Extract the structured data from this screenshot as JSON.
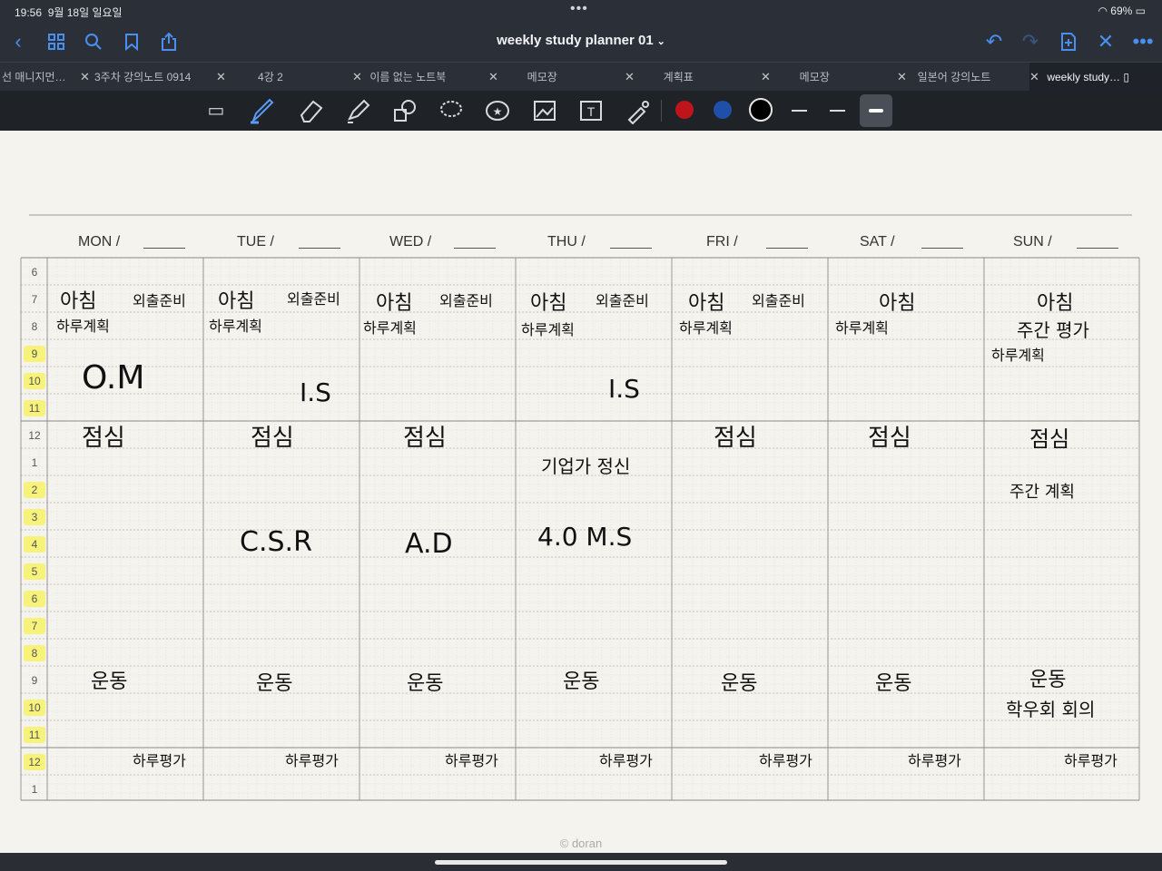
{
  "status": {
    "time": "19:56",
    "date": "9월 18일 일요일",
    "battery": "69%"
  },
  "nav": {
    "title": "weekly study planner 01",
    "left_icons": [
      "back-icon",
      "grid-icon",
      "search-icon",
      "bookmark-icon",
      "share-icon"
    ],
    "right_icons": [
      "undo-icon",
      "redo-icon",
      "add-page-icon",
      "close-icon",
      "more-icon"
    ]
  },
  "tabs": [
    {
      "label": "선 매니지먼…"
    },
    {
      "label": "3주차 강의노트 0914"
    },
    {
      "label": "4강 2"
    },
    {
      "label": "이름 없는 노트북"
    },
    {
      "label": "메모장"
    },
    {
      "label": "계획표"
    },
    {
      "label": "메모장"
    },
    {
      "label": "일본어 강의노트"
    },
    {
      "label": "weekly study…"
    }
  ],
  "toolbar": {
    "tools": [
      "read-mode-icon",
      "pen-icon",
      "eraser-icon",
      "highlighter-icon",
      "shapes-icon",
      "lasso-icon",
      "sticker-icon",
      "image-icon",
      "text-icon",
      "laser-pointer-icon"
    ],
    "colors": [
      "#c0141c",
      "#1f4fa8",
      "#111111"
    ]
  },
  "planner": {
    "days": [
      "MON /",
      "TUE /",
      "WED /",
      "THU /",
      "FRI /",
      "SAT /",
      "SUN /"
    ],
    "hours": [
      "6",
      "7",
      "8",
      "9",
      "10",
      "11",
      "12",
      "1",
      "2",
      "3",
      "4",
      "5",
      "6",
      "7",
      "8",
      "9",
      "10",
      "11",
      "12",
      "1"
    ],
    "highlighted_hour_rows": [
      3,
      4,
      5,
      8,
      9,
      10,
      11,
      12,
      13,
      14,
      16,
      17,
      18
    ],
    "entries": {
      "mon_morning": "아침",
      "mon_prep": "외출준비",
      "mon_plan": "하루계획",
      "mon_block": "O.M",
      "mon_lunch": "점심",
      "mon_exercise": "운동",
      "mon_review": "하루평가",
      "tue_morning": "아침",
      "tue_prep": "외출준비",
      "tue_plan": "하루계획",
      "tue_block1": "I.S",
      "tue_lunch": "점심",
      "tue_block2": "C.S.R",
      "tue_exercise": "운동",
      "tue_review": "하루평가",
      "wed_morning": "아침",
      "wed_prep": "외출준비",
      "wed_plan": "하루계획",
      "wed_lunch": "점심",
      "wed_block": "A.D",
      "wed_exercise": "운동",
      "wed_review": "하루평가",
      "thu_morning": "아침",
      "thu_prep": "외출준비",
      "thu_plan": "하루계획",
      "thu_block1": "I.S",
      "thu_spirit": "기업가 정신",
      "thu_block2": "4.0 M.S",
      "thu_exercise": "운동",
      "thu_review": "하루평가",
      "fri_morning": "아침",
      "fri_prep": "외출준비",
      "fri_plan": "하루계획",
      "fri_lunch": "점심",
      "fri_exercise": "운동",
      "fri_review": "하루평가",
      "sat_morning": "아침",
      "sat_plan": "하루계획",
      "sat_lunch": "점심",
      "sat_exercise": "운동",
      "sat_review": "하루평가",
      "sun_morning": "아침",
      "sun_weekly_review": "주간 평가",
      "sun_plan": "하루계획",
      "sun_lunch": "점심",
      "sun_weekly_plan": "주간 계획",
      "sun_exercise": "운동",
      "sun_meeting": "학우회 회의",
      "sun_review": "하루평가"
    },
    "footer": "© doran"
  }
}
